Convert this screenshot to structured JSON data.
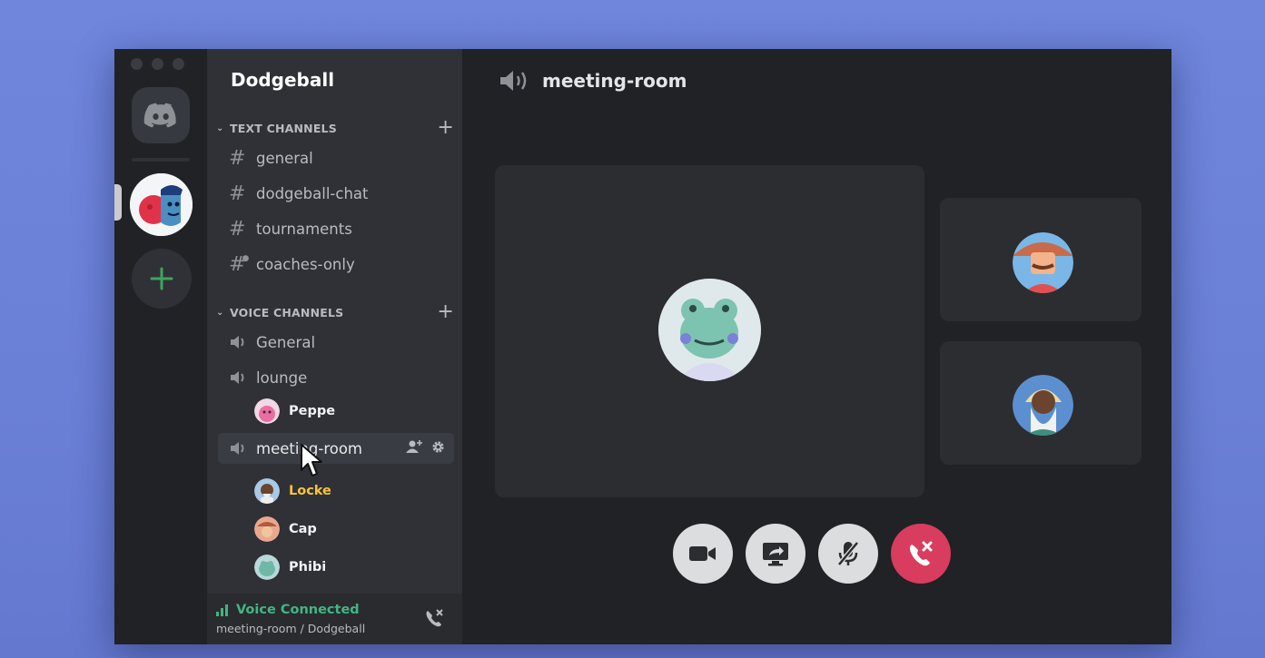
{
  "server": {
    "name": "Dodgeball"
  },
  "categories": {
    "text": {
      "label": "TEXT CHANNELS"
    },
    "voice": {
      "label": "VOICE CHANNELS"
    }
  },
  "text_channels": [
    {
      "label": "general",
      "icon": "hash-icon"
    },
    {
      "label": "dodgeball-chat",
      "icon": "hash-icon"
    },
    {
      "label": "tournaments",
      "icon": "hash-icon"
    },
    {
      "label": "coaches-only",
      "icon": "hash-lock-icon"
    }
  ],
  "voice_channels": [
    {
      "label": "General",
      "icon": "speaker-icon"
    },
    {
      "label": "lounge",
      "icon": "speaker-icon",
      "members": [
        {
          "name": "Peppe"
        }
      ]
    },
    {
      "label": "meeting-room",
      "icon": "speaker-icon",
      "active": true,
      "members": [
        {
          "name": "Locke"
        },
        {
          "name": "Cap"
        },
        {
          "name": "Phibi"
        }
      ]
    }
  ],
  "voice_status": {
    "title": "Voice Connected",
    "subtitle": "meeting-room / Dodgeball"
  },
  "main": {
    "title": "meeting-room"
  },
  "controls": [
    {
      "name": "camera-button",
      "icon": "video-camera-icon"
    },
    {
      "name": "screen-share-button",
      "icon": "screen-share-icon"
    },
    {
      "name": "mute-button",
      "icon": "microphone-muted-icon"
    },
    {
      "name": "disconnect-button",
      "icon": "phone-hangup-icon"
    }
  ],
  "colors": {
    "accent_green": "#43b581",
    "speaking_yellow": "#f9c33c",
    "disconnect_red": "#d83c5e",
    "plus_green": "#3ba55c"
  }
}
